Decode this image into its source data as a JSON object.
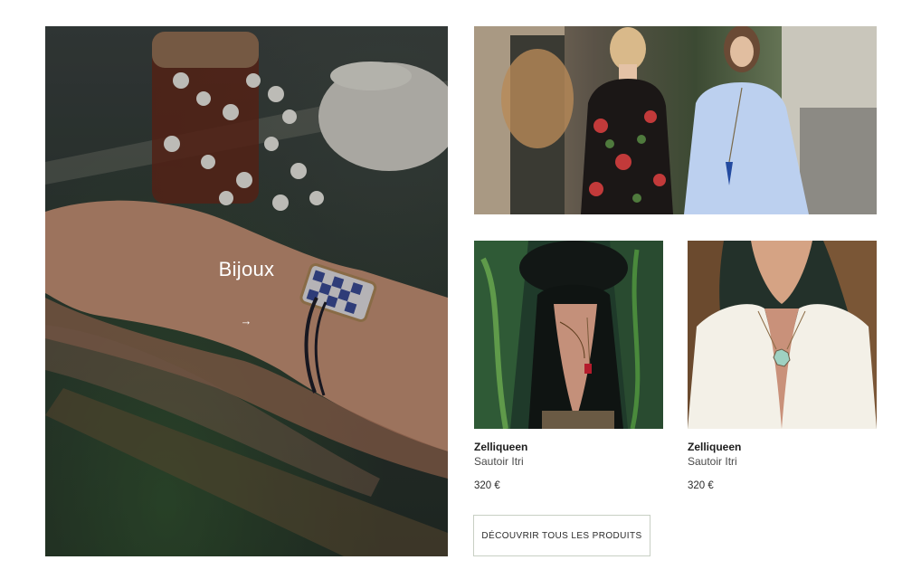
{
  "hero": {
    "title": "Bijoux",
    "arrow": "→"
  },
  "products": [
    {
      "brand": "Zelliqueen",
      "name": "Sautoir Itri",
      "price": "320 €"
    },
    {
      "brand": "Zelliqueen",
      "name": "Sautoir Itri",
      "price": "320 €"
    }
  ],
  "cta": {
    "label": "DÉCOUVRIR TOUS LES PRODUITS"
  }
}
